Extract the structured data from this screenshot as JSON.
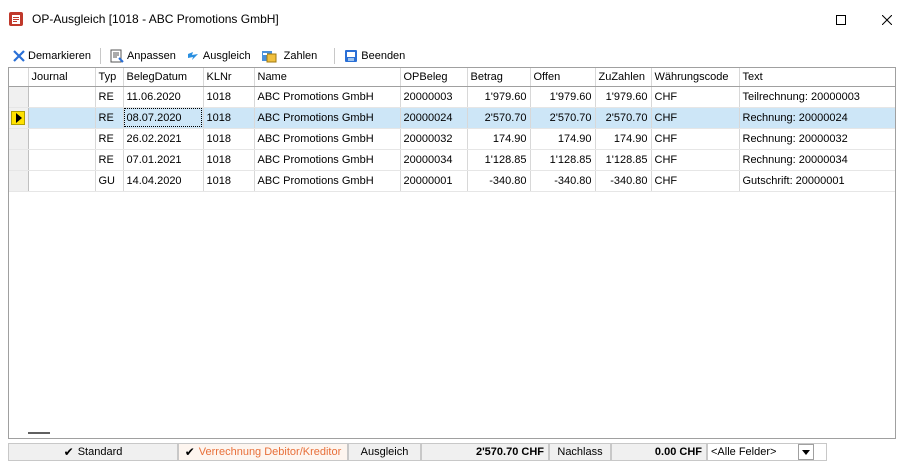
{
  "window": {
    "title": "OP-Ausgleich [1018 - ABC Promotions GmbH]",
    "maximize_icon": "maximize-icon",
    "close_icon": "close-icon"
  },
  "toolbar": {
    "demarkieren": "Demarkieren",
    "anpassen": "Anpassen",
    "ausgleich": "Ausgleich",
    "zahlen": "Zahlen",
    "beenden": "Beenden"
  },
  "grid": {
    "columns": [
      "Journal",
      "Typ",
      "BelegDatum",
      "KLNr",
      "Name",
      "OPBeleg",
      "Betrag",
      "Offen",
      "ZuZahlen",
      "Währungscode",
      "Text"
    ],
    "rows": [
      {
        "journal": "",
        "typ": "RE",
        "datum": "11.06.2020",
        "klnr": "1018",
        "name": "ABC Promotions GmbH",
        "opbeleg": "20000003",
        "betrag": "1'979.60",
        "offen": "1'979.60",
        "zuzahlen": "1'979.60",
        "waehrung": "CHF",
        "text": "Teilrechnung: 20000003"
      },
      {
        "journal": "",
        "typ": "RE",
        "datum": "08.07.2020",
        "klnr": "1018",
        "name": "ABC Promotions GmbH",
        "opbeleg": "20000024",
        "betrag": "2'570.70",
        "offen": "2'570.70",
        "zuzahlen": "2'570.70",
        "waehrung": "CHF",
        "text": "Rechnung: 20000024"
      },
      {
        "journal": "",
        "typ": "RE",
        "datum": "26.02.2021",
        "klnr": "1018",
        "name": "ABC Promotions GmbH",
        "opbeleg": "20000032",
        "betrag": "174.90",
        "offen": "174.90",
        "zuzahlen": "174.90",
        "waehrung": "CHF",
        "text": "Rechnung: 20000032"
      },
      {
        "journal": "",
        "typ": "RE",
        "datum": "07.01.2021",
        "klnr": "1018",
        "name": "ABC Promotions GmbH",
        "opbeleg": "20000034",
        "betrag": "1'128.85",
        "offen": "1'128.85",
        "zuzahlen": "1'128.85",
        "waehrung": "CHF",
        "text": "Rechnung: 20000034"
      },
      {
        "journal": "",
        "typ": "GU",
        "datum": "14.04.2020",
        "klnr": "1018",
        "name": "ABC Promotions GmbH",
        "opbeleg": "20000001",
        "betrag": "-340.80",
        "offen": "-340.80",
        "zuzahlen": "-340.80",
        "waehrung": "CHF",
        "text": "Gutschrift: 20000001"
      }
    ],
    "selected_row": 1
  },
  "status": {
    "standard": "Standard",
    "verrechnung": "Verrechnung Debitor/Kreditor",
    "ausgleich_label": "Ausgleich",
    "ausgleich_value": "2'570.70 CHF",
    "nachlass_label": "Nachlass",
    "nachlass_value": "0.00 CHF",
    "filter": "<Alle Felder>"
  },
  "colors": {
    "selection": "#cde6f7",
    "indicator": "#ffe100",
    "verrechnung_text": "#e8703a"
  }
}
